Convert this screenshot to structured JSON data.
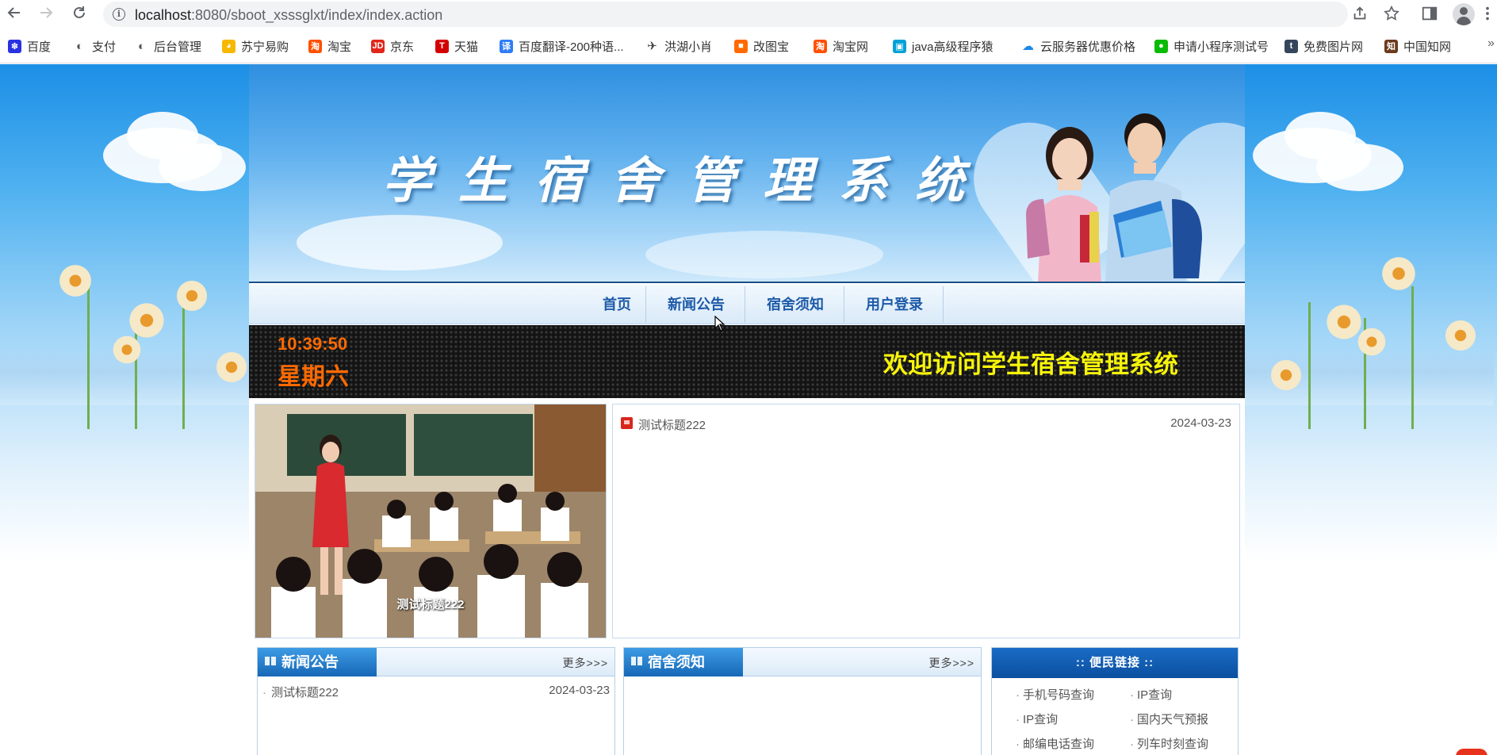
{
  "browser": {
    "url_host": "localhost",
    "url_path": ":8080/sboot_xsssglxt/index/index.action",
    "bookmarks": [
      {
        "label": "百度",
        "icon": "baidu-icon",
        "color": "#2932e1"
      },
      {
        "label": "支付",
        "icon": "globe-icon",
        "color": "#555555"
      },
      {
        "label": "后台管理",
        "icon": "globe-icon",
        "color": "#555555"
      },
      {
        "label": "苏宁易购",
        "icon": "suning-icon",
        "color": "#f6b800"
      },
      {
        "label": "淘宝",
        "icon": "taobao-icon",
        "color": "#ff5000"
      },
      {
        "label": "京东",
        "icon": "jd-icon",
        "color": "#e1251b"
      },
      {
        "label": "天猫",
        "icon": "tmall-icon",
        "color": "#d40000"
      },
      {
        "label": "百度翻译-200种语...",
        "icon": "translate-icon",
        "color": "#2f7df6"
      },
      {
        "label": "洪湖小肖",
        "icon": "bird-icon",
        "color": "#444444"
      },
      {
        "label": "改图宝",
        "icon": "gaitubao-icon",
        "color": "#ff6a00"
      },
      {
        "label": "淘宝网",
        "icon": "taobao-icon",
        "color": "#ff5000"
      },
      {
        "label": "java高级程序猿",
        "icon": "bilibili-icon",
        "color": "#00a1d6"
      },
      {
        "label": "云服务器优惠价格",
        "icon": "cloud-icon",
        "color": "#1e88e5"
      },
      {
        "label": "申请小程序测试号",
        "icon": "wechat-icon",
        "color": "#09bb07"
      },
      {
        "label": "免费图片网",
        "icon": "tumblr-icon",
        "color": "#35465c"
      },
      {
        "label": "中国知网",
        "icon": "cnki-icon",
        "color": "#6b3b1e"
      }
    ],
    "more": "»"
  },
  "banner": {
    "title": "学生宿舍管理系统"
  },
  "nav": {
    "items": [
      "首页",
      "新闻公告",
      "宿舍须知",
      "用户登录"
    ]
  },
  "led": {
    "time": "10:39:50",
    "weekday": "星期六",
    "welcome": "欢迎访问学生宿舍管理系统"
  },
  "slide": {
    "caption": "测试标题222"
  },
  "news": {
    "items": [
      {
        "title": "测试标题222",
        "date": "2024-03-23"
      }
    ]
  },
  "panels": {
    "news": {
      "title": "新闻公告",
      "more": "更多>>>",
      "items": [
        {
          "title": "测试标题222",
          "date": "2024-03-23"
        }
      ]
    },
    "notice": {
      "title": "宿舍须知",
      "more": "更多>>>"
    },
    "links": {
      "title": ":: 便民链接 ::",
      "items": [
        "手机号码查询",
        "IP查询",
        "IP查询",
        "国内天气预报",
        "邮编电话查询",
        "列车时刻查询"
      ]
    }
  },
  "colors": {
    "nav_text": "#1d5aa8",
    "led_orange": "#ff6a00",
    "led_yellow": "#f7f40a",
    "panel_blue": "#1668b7"
  }
}
